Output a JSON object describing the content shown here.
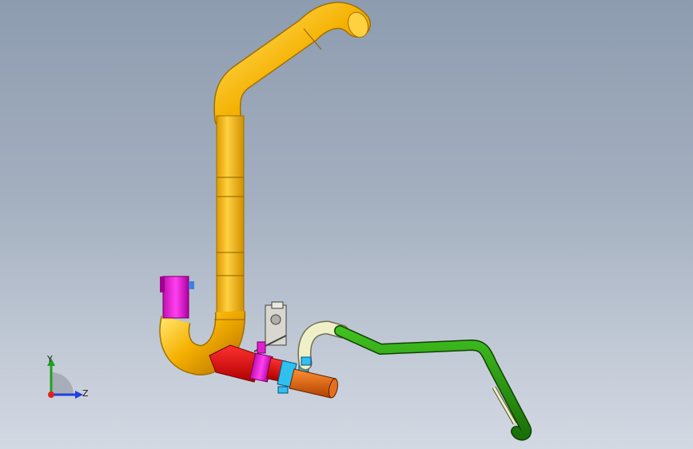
{
  "viewport": {
    "background_top": "#8e9cb0",
    "background_bottom": "#d3d9e3"
  },
  "model": {
    "parts": [
      {
        "name": "main-duct",
        "color": "#f5b000"
      },
      {
        "name": "upper-inlet-tube",
        "color": "#e020d0"
      },
      {
        "name": "lower-coupling-sleeve",
        "color": "#e020d0"
      },
      {
        "name": "red-connector-pipe",
        "color": "#e01010"
      },
      {
        "name": "cyan-clamp",
        "color": "#20b0e0"
      },
      {
        "name": "orange-nozzle",
        "color": "#e06010"
      },
      {
        "name": "mounting-bracket",
        "color": "#d8d8d0"
      },
      {
        "name": "cream-hose",
        "color": "#efefc8"
      },
      {
        "name": "green-hose",
        "color": "#2a9a10"
      },
      {
        "name": "small-strap",
        "color": "#efefc8"
      }
    ]
  },
  "triad": {
    "y_label": "Y",
    "z_label": "Z",
    "y_color": "#20a020",
    "z_color": "#2040e0",
    "origin_color": "#e02020"
  }
}
